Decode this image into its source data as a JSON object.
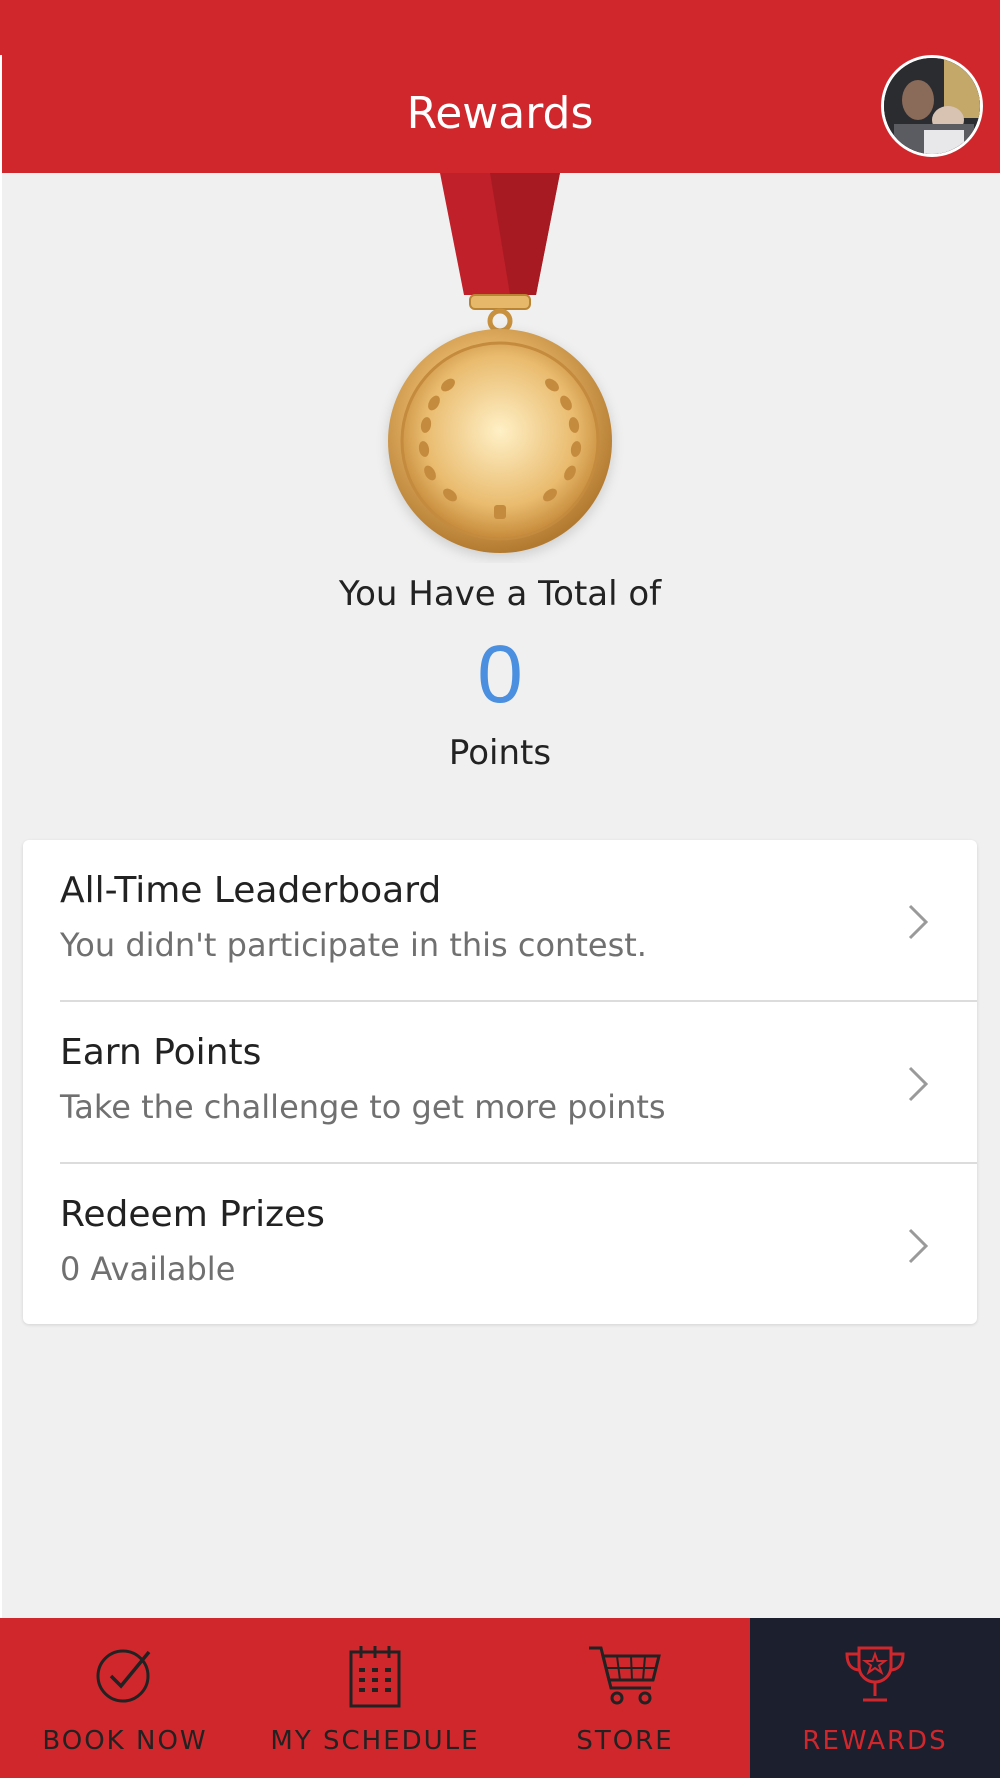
{
  "header": {
    "title": "Rewards"
  },
  "summary": {
    "label": "You Have a Total of",
    "points": "0",
    "unit": "Points"
  },
  "list": [
    {
      "title": "All-Time Leaderboard",
      "subtitle": "You didn't participate in this contest."
    },
    {
      "title": "Earn Points",
      "subtitle": "Take the challenge to get more points"
    },
    {
      "title": "Redeem Prizes",
      "subtitle": "0 Available"
    }
  ],
  "tabs": [
    {
      "label": "BOOK NOW",
      "icon": "check-circle-icon"
    },
    {
      "label": "MY SCHEDULE",
      "icon": "calendar-icon"
    },
    {
      "label": "STORE",
      "icon": "cart-icon"
    },
    {
      "label": "REWARDS",
      "icon": "trophy-icon",
      "active": true
    }
  ],
  "colors": {
    "brand": "#d0272d",
    "points": "#4a8fe0",
    "active_tab_bg": "#1c1f2e"
  }
}
